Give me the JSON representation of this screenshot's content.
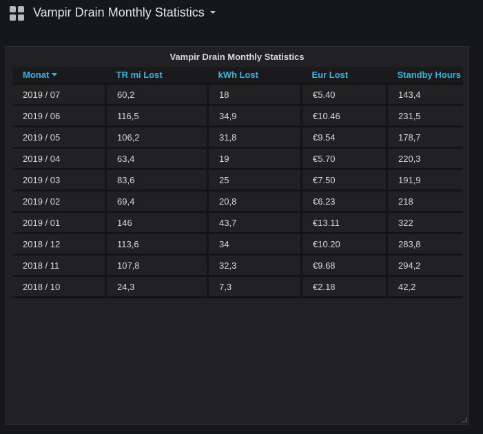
{
  "dashboard": {
    "icon": "grid-icon",
    "title": "Vampir Drain Monthly Statistics"
  },
  "panel": {
    "title": "Vampir Drain Monthly Statistics",
    "columns": [
      "Monat",
      "TR mi Lost",
      "kWh Lost",
      "Eur Lost",
      "Standby Hours"
    ],
    "sort_icon": "caret-down-icon",
    "rows": [
      [
        "2019 / 07",
        "60,2",
        "18",
        "€5.40",
        "143,4"
      ],
      [
        "2019 / 06",
        "116,5",
        "34,9",
        "€10.46",
        "231,5"
      ],
      [
        "2019 / 05",
        "106,2",
        "31,8",
        "€9.54",
        "178,7"
      ],
      [
        "2019 / 04",
        "63,4",
        "19",
        "€5.70",
        "220,3"
      ],
      [
        "2019 / 03",
        "83,6",
        "25",
        "€7.50",
        "191,9"
      ],
      [
        "2019 / 02",
        "69,4",
        "20,8",
        "€6.23",
        "218"
      ],
      [
        "2019 / 01",
        "146",
        "43,7",
        "€13.11",
        "322"
      ],
      [
        "2018 / 12",
        "113,6",
        "34",
        "€10.20",
        "283,8"
      ],
      [
        "2018 / 11",
        "107,8",
        "32,3",
        "€9.68",
        "294,2"
      ],
      [
        "2018 / 10",
        "24,3",
        "7,3",
        "€2.18",
        "42,2"
      ]
    ]
  },
  "colors": {
    "background": "#161719",
    "panel": "#212124",
    "accent": "#33b5e5",
    "text": "#d8d9da"
  }
}
